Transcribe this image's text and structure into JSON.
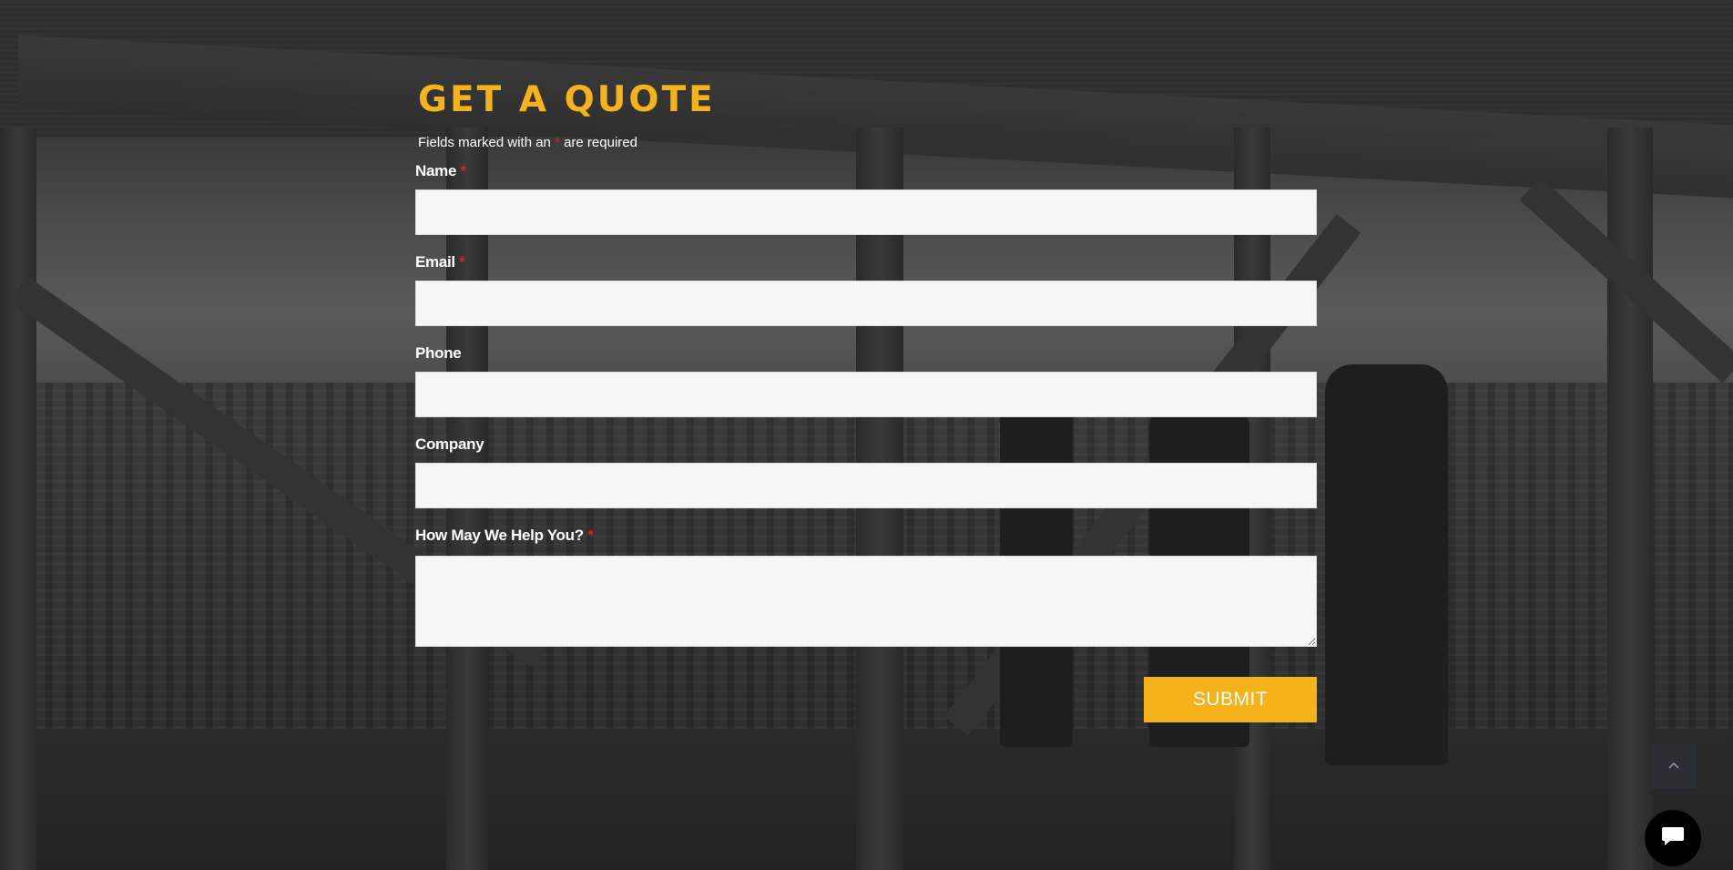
{
  "form": {
    "title": "GET A QUOTE",
    "required_note": {
      "before": "Fields marked with an ",
      "asterisk": "*",
      "after": " are required"
    },
    "fields": [
      {
        "label": "Name",
        "required_mark": "*",
        "value": "",
        "type": "text"
      },
      {
        "label": "Email",
        "required_mark": "*",
        "value": "",
        "type": "email"
      },
      {
        "label": "Phone",
        "required_mark": "",
        "value": "",
        "type": "tel"
      },
      {
        "label": "Company",
        "required_mark": "",
        "value": "",
        "type": "text"
      },
      {
        "label": "How May We Help You?",
        "required_mark": "*",
        "value": "",
        "type": "textarea"
      }
    ],
    "submit_label": "SUBMIT"
  },
  "widgets": {
    "scroll_top_icon": "chevron-up-icon",
    "chat_icon": "chat-bubble-icon"
  },
  "colors": {
    "accent": "#f4b21b",
    "required": "#e0201b",
    "input_bg": "#f6f6f6",
    "scroll_top_bg": "#2b2e35",
    "chat_bg": "#000000"
  }
}
